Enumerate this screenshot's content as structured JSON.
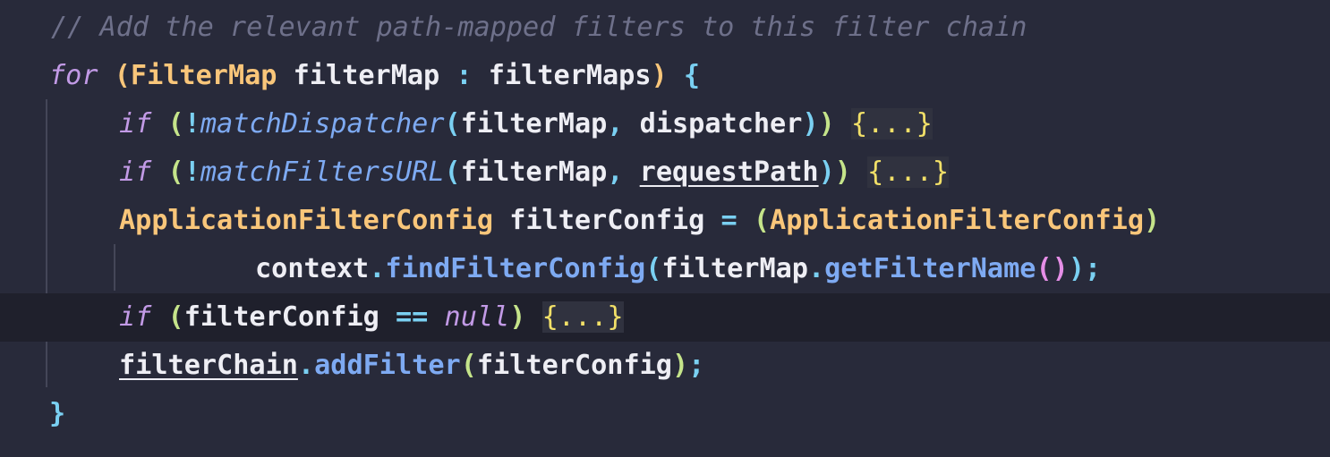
{
  "editor": {
    "comment": "// Add the relevant path-mapped filters to this filter chain",
    "line_for": {
      "keyword": "for",
      "open_paren": "(",
      "type": "FilterMap",
      "var": " filterMap ",
      "colon": ":",
      "iterable": " filterMaps",
      "close_paren": ")",
      "brace": " {"
    },
    "line_if1": {
      "keyword": "if",
      "open_paren": " (",
      "not": "!",
      "method": "matchDispatcher",
      "open_paren2": "(",
      "arg1": "filterMap",
      "comma": ",",
      "arg2": " dispatcher",
      "close_paren2": ")",
      "close_paren": ")",
      "fold": "{...}"
    },
    "line_if2": {
      "keyword": "if",
      "open_paren": " (",
      "not": "!",
      "method": "matchFiltersURL",
      "open_paren2": "(",
      "arg1": "filterMap",
      "comma": ",",
      "arg2": "requestPath",
      "close_paren2": ")",
      "close_paren": ")",
      "fold": "{...}"
    },
    "line_decl": {
      "type": "ApplicationFilterConfig",
      "var": " filterConfig ",
      "eq": "=",
      "open_paren": " (",
      "cast_type": "ApplicationFilterConfig",
      "close_paren": ")"
    },
    "line_cont": {
      "receiver": "context",
      "dot": ".",
      "method": "findFilterConfig",
      "open_paren": "(",
      "arg": "filterMap",
      "dot2": ".",
      "method2": "getFilterName",
      "open_paren2": "(",
      "close_paren2": ")",
      "close_paren": ")",
      "semi": ";"
    },
    "line_if3": {
      "keyword": "if",
      "open_paren": " (",
      "var": "filterConfig ",
      "op": "==",
      "null_kw": "null",
      "close_paren": ")",
      "fold": "{...}"
    },
    "line_add": {
      "receiver": "filterChain",
      "dot": ".",
      "method": "addFilter",
      "open_paren": "(",
      "arg": "filterConfig",
      "close_paren": ")",
      "semi": ";"
    },
    "closing_brace": "}"
  },
  "colors": {
    "background": "#282a3a",
    "current_line": "#1f202c",
    "comment": "#6e708a",
    "keyword": "#c29ae6",
    "type": "#f9c67a",
    "method": "#7eaaf2",
    "fold": "#f2e068"
  }
}
